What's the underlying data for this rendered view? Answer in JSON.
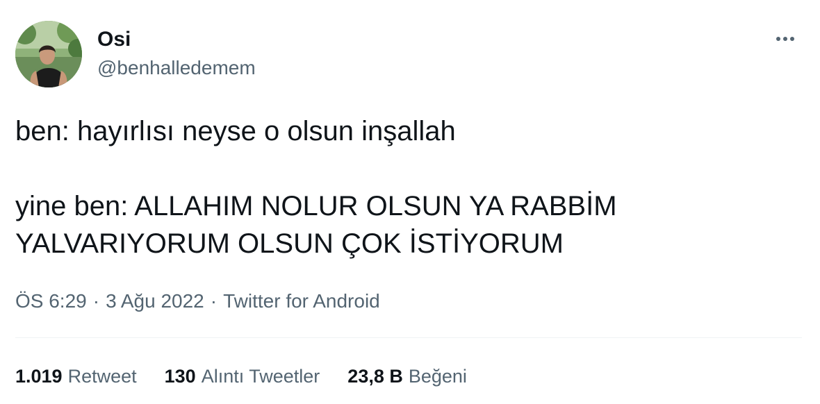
{
  "author": {
    "name": "Osi",
    "handle": "@benhalledemem"
  },
  "tweet": {
    "line1": "ben: hayırlısı neyse o olsun inşallah",
    "line2": "yine ben: ALLAHIM NOLUR OLSUN YA RABBİM",
    "line3": "YALVARIYORUM OLSUN ÇOK İSTİYORUM"
  },
  "meta": {
    "time": "ÖS 6:29",
    "date": "3 Ağu 2022",
    "source": "Twitter for Android",
    "separator": "·"
  },
  "stats": {
    "retweets": {
      "count": "1.019",
      "label": "Retweet"
    },
    "quotes": {
      "count": "130",
      "label": "Alıntı Tweetler"
    },
    "likes": {
      "count": "23,8 B",
      "label": "Beğeni"
    }
  },
  "icons": {
    "more": "more-horizontal-icon"
  },
  "colors": {
    "text_primary": "#0f1419",
    "text_secondary": "#536471",
    "divider": "#eff3f4"
  }
}
